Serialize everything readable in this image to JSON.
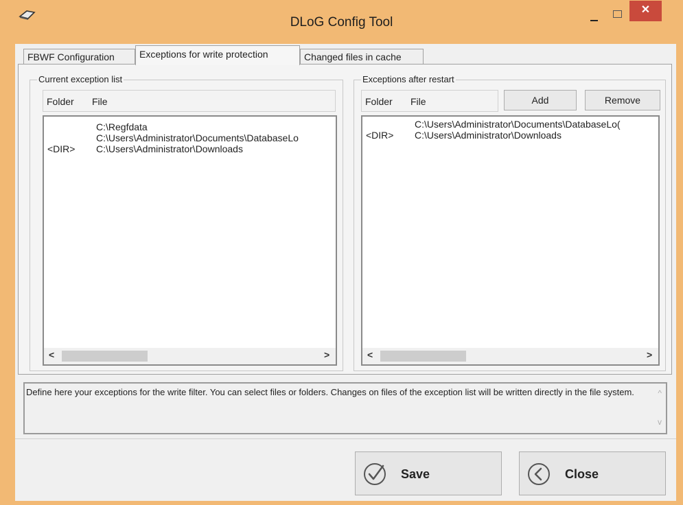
{
  "window": {
    "title": "DLoG Config Tool",
    "icon": "drive-icon",
    "accent": "#f2b974",
    "close_color": "#c94a3c",
    "close_glyph": "✕"
  },
  "tabs": [
    {
      "label": "FBWF Configuration",
      "active": false
    },
    {
      "label": "Exceptions for write protection",
      "active": true
    },
    {
      "label": "Changed files in cache",
      "active": false
    }
  ],
  "current_list": {
    "group_label": "Current exception list",
    "columns": [
      "Folder",
      "File"
    ],
    "rows": [
      {
        "folder": "",
        "file": "C:\\Regfdata"
      },
      {
        "folder": "",
        "file": "C:\\Users\\Administrator\\Documents\\DatabaseLo"
      },
      {
        "folder": "<DIR>",
        "file": "C:\\Users\\Administrator\\Downloads"
      }
    ]
  },
  "restart_list": {
    "group_label": "Exceptions after restart",
    "columns": [
      "Folder",
      "File"
    ],
    "add_label": "Add",
    "remove_label": "Remove",
    "rows": [
      {
        "folder": "",
        "file": "C:\\Users\\Administrator\\Documents\\DatabaseLo("
      },
      {
        "folder": "<DIR>",
        "file": "C:\\Users\\Administrator\\Downloads"
      }
    ]
  },
  "scroll": {
    "left_glyph": "<",
    "right_glyph": ">",
    "up_glyph": "^",
    "down_glyph": "v"
  },
  "description": "Define here your exceptions for the write filter. You can select files or folders. Changes on files of the exception list will be written directly in the file system.",
  "buttons": {
    "save_label": "Save",
    "close_label": "Close"
  }
}
